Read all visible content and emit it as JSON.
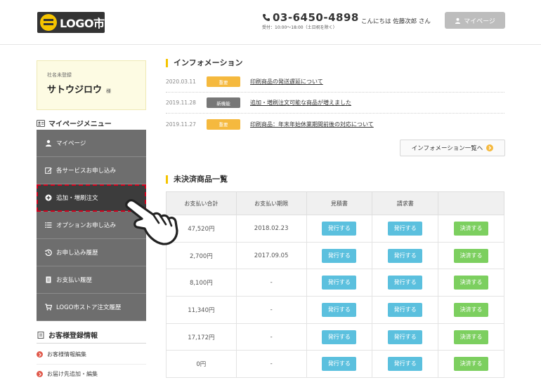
{
  "header": {
    "logo_text": "LOGO市",
    "phone": "03-6450-4898",
    "hours": "受付：10:00〜18:00（土日祝を除く）",
    "greeting": "こんにちは 佐藤次郎 さん",
    "mypage_button": "マイページ"
  },
  "member": {
    "label": "社名未登録",
    "name": "サトウジロウ",
    "honorific": "様"
  },
  "mypage_menu": {
    "heading": "マイページメニュー",
    "items": [
      {
        "label": "マイページ",
        "icon": "user-icon"
      },
      {
        "label": "各サービスお申し込み",
        "icon": "edit-icon"
      },
      {
        "label": "追加・増刷注文",
        "icon": "plus-circle-icon"
      },
      {
        "label": "オプションお申し込み",
        "icon": "list-icon"
      },
      {
        "label": "お申し込み履歴",
        "icon": "history-icon"
      },
      {
        "label": "お支払い履歴",
        "icon": "receipt-icon"
      },
      {
        "label": "LOGO市ストア注文履歴",
        "icon": "cart-icon"
      }
    ],
    "active_index": 2
  },
  "customer": {
    "heading": "お客様登録情報",
    "items": [
      "お客様情報編集",
      "お届け先追加・編集"
    ]
  },
  "info": {
    "heading": "インフォメーション",
    "rows": [
      {
        "date": "2020.03.11",
        "badge": "重要",
        "badge_color": "#f5b93e",
        "title": "印刷商品の発送遅延について"
      },
      {
        "date": "2019.11.28",
        "badge": "新機能",
        "badge_color": "#777777",
        "title": "追加・増刷注文可能な商品が増えました"
      },
      {
        "date": "2019.11.27",
        "badge": "重要",
        "badge_color": "#f5b93e",
        "title": "印刷商品：年末年始休業期間前後の対応について"
      }
    ],
    "all_button": "インフォメーション一覧へ"
  },
  "unpaid": {
    "heading": "未決済商品一覧",
    "columns": [
      "お支払い合計",
      "お支払い期限",
      "見積書",
      "請求書",
      ""
    ],
    "issue_label": "発行する",
    "pay_label": "決済する",
    "rows": [
      {
        "total": "47,520円",
        "deadline": "2018.02.23"
      },
      {
        "total": "2,700円",
        "deadline": "2017.09.05"
      },
      {
        "total": "8,100円",
        "deadline": "-"
      },
      {
        "total": "11,340円",
        "deadline": "-"
      },
      {
        "total": "17,172円",
        "deadline": "-"
      },
      {
        "total": "0円",
        "deadline": "-"
      }
    ]
  },
  "colors": {
    "accent": "#f5c400",
    "menu_bg": "#6e6e6e",
    "menu_active_bg": "#3c3c3c",
    "highlight_dash": "#d2001c",
    "issue_button": "#5bc0de",
    "pay_button": "#7ccf5f"
  }
}
